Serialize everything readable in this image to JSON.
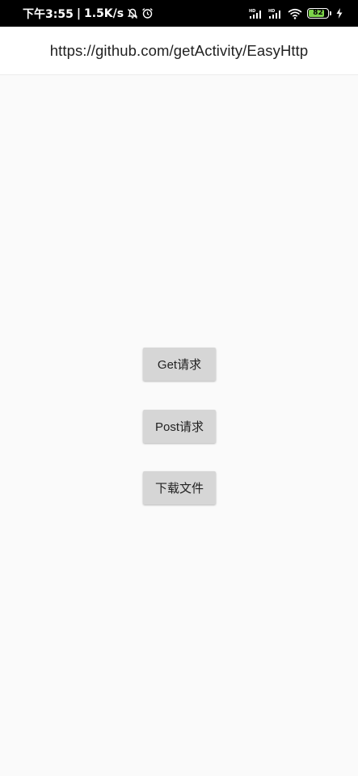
{
  "status_bar": {
    "time": "下午3:55",
    "separator": "|",
    "net_speed": "1.5K/s",
    "battery_level": "82",
    "battery_color": "#7cd44a",
    "icons": [
      "notifications-off-icon",
      "alarm-icon",
      "hd-signal-icon",
      "hd-signal-icon",
      "wifi-icon",
      "battery-icon",
      "charging-icon"
    ]
  },
  "app_bar": {
    "title": "https://github.com/getActivity/EasyHttp"
  },
  "main": {
    "buttons": [
      {
        "label": "Get请求"
      },
      {
        "label": "Post请求"
      },
      {
        "label": "下载文件"
      }
    ]
  },
  "colors": {
    "status_bar_bg": "#000000",
    "app_bar_bg": "#ffffff",
    "page_bg": "#fafafa",
    "button_bg": "#d6d6d6"
  }
}
